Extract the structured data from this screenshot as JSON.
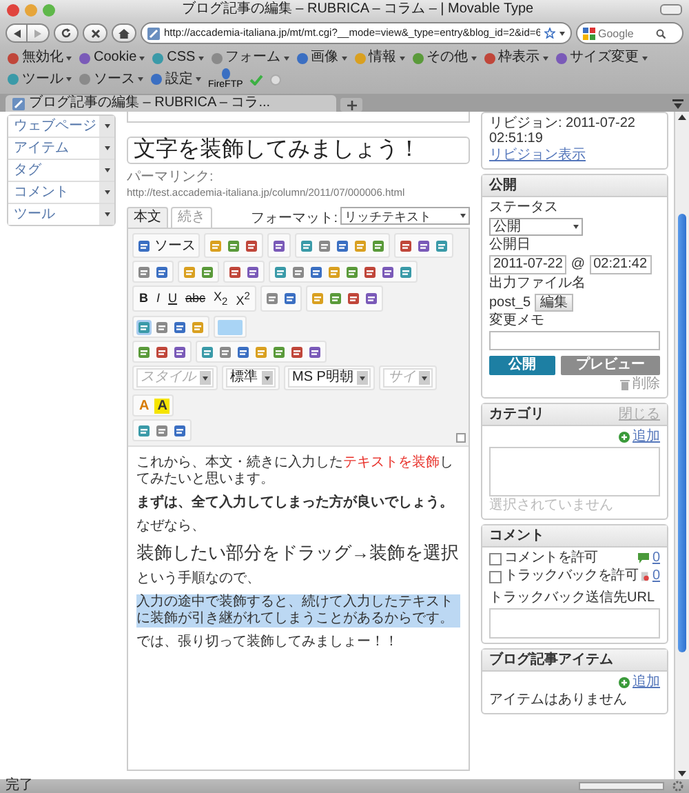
{
  "window": {
    "title": "ブログ記事の編集 – RUBRICA – コラム – | Movable Type"
  },
  "address": {
    "url": "http://accademia-italiana.jp/mt/mt.cgi?__mode=view&_type=entry&blog_id=2&id=6"
  },
  "search": {
    "placeholder": "Google"
  },
  "bookmarks": [
    {
      "label": "無効化",
      "kind": "menu"
    },
    {
      "label": "Cookie",
      "kind": "menu"
    },
    {
      "label": "CSS",
      "kind": "menu"
    },
    {
      "label": "フォーム",
      "kind": "menu"
    },
    {
      "label": "画像",
      "kind": "menu"
    },
    {
      "label": "情報",
      "kind": "menu"
    },
    {
      "label": "その他",
      "kind": "menu"
    },
    {
      "label": "枠表示",
      "kind": "menu"
    },
    {
      "label": "サイズ変更",
      "kind": "menu"
    },
    {
      "label": "ツール",
      "kind": "menu"
    },
    {
      "label": "ソース",
      "kind": "menu"
    },
    {
      "label": "設定",
      "kind": "menu"
    },
    {
      "label": "FireFTP",
      "kind": "button"
    }
  ],
  "tabs": [
    {
      "label": "ブログ記事の編集 – RUBRICA – コラ...",
      "selected": true
    }
  ],
  "sidebar": {
    "items": [
      {
        "label": "ウェブページ"
      },
      {
        "label": "アイテム"
      },
      {
        "label": "タグ"
      },
      {
        "label": "コメント"
      },
      {
        "label": "ツール"
      }
    ]
  },
  "entry": {
    "title": "文字を装飾してみましょう！",
    "permalink_label": "パーマリンク:",
    "permalink": "http://test.accademia-italiana.jp/column/2011/07/000006.html",
    "tabs": [
      {
        "label": "本文",
        "selected": true
      },
      {
        "label": "続き",
        "selected": false
      }
    ],
    "format_label": "フォーマット:",
    "format": "リッチテキスト",
    "toolbar": [
      [
        [
          {
            "kind": "icon_text",
            "text": "ソース"
          }
        ],
        [
          {
            "kind": "icon"
          },
          {
            "kind": "icon"
          },
          {
            "kind": "icon"
          }
        ],
        [
          {
            "kind": "icon"
          }
        ],
        [
          {
            "kind": "icon"
          },
          {
            "kind": "icon"
          },
          {
            "kind": "icon"
          },
          {
            "kind": "icon"
          },
          {
            "kind": "icon"
          }
        ],
        [
          {
            "kind": "icon"
          },
          {
            "kind": "icon"
          },
          {
            "kind": "icon"
          }
        ]
      ],
      [
        [
          {
            "kind": "icon"
          },
          {
            "kind": "icon"
          }
        ],
        [
          {
            "kind": "icon"
          },
          {
            "kind": "icon"
          }
        ],
        [
          {
            "kind": "icon"
          },
          {
            "kind": "icon"
          }
        ],
        [
          {
            "kind": "icon"
          },
          {
            "kind": "icon"
          },
          {
            "kind": "icon"
          },
          {
            "kind": "icon"
          },
          {
            "kind": "icon"
          },
          {
            "kind": "icon"
          },
          {
            "kind": "icon"
          },
          {
            "kind": "icon"
          }
        ]
      ],
      [
        [
          {
            "kind": "text",
            "text": "B"
          },
          {
            "kind": "text",
            "text": "I"
          },
          {
            "kind": "text",
            "text": "U"
          },
          {
            "kind": "text",
            "text": "abc"
          },
          {
            "kind": "text",
            "text": "X$_{2}$"
          },
          {
            "kind": "text",
            "text": "X$^{2}$"
          }
        ],
        [
          {
            "kind": "icon"
          },
          {
            "kind": "icon"
          }
        ],
        [
          {
            "kind": "icon"
          },
          {
            "kind": "icon"
          },
          {
            "kind": "icon"
          },
          {
            "kind": "icon"
          }
        ],
        [
          {
            "kind": "icon",
            "active": true
          },
          {
            "kind": "icon",
            "active": false
          },
          {
            "kind": "icon",
            "active": false
          },
          {
            "kind": "icon",
            "active": false
          }
        ],
        [
          {
            "kind": "swatch"
          }
        ]
      ],
      [
        [
          {
            "kind": "icon"
          },
          {
            "kind": "icon"
          },
          {
            "kind": "icon"
          }
        ],
        [
          {
            "kind": "icon"
          },
          {
            "kind": "icon"
          },
          {
            "kind": "icon"
          },
          {
            "kind": "icon"
          },
          {
            "kind": "icon"
          },
          {
            "kind": "icon"
          },
          {
            "kind": "icon"
          }
        ]
      ],
      [
        [
          {
            "kind": "select",
            "text": "スタイル",
            "disabled": true
          }
        ],
        [
          {
            "kind": "select",
            "text": "標準",
            "disabled": false
          }
        ],
        [
          {
            "kind": "select",
            "text": "MS P明朝",
            "disabled": false
          }
        ],
        [
          {
            "kind": "select",
            "text": "サイ",
            "disabled": true
          }
        ],
        [
          {
            "kind": "fontcolor",
            "text": "A"
          },
          {
            "kind": "bgcolor",
            "text": "A"
          }
        ]
      ],
      [
        [
          {
            "kind": "icon"
          },
          {
            "kind": "icon"
          },
          {
            "kind": "icon"
          }
        ]
      ]
    ],
    "content": [
      {
        "kind": "normal",
        "highlighted": false,
        "parts": [
          {
            "text": "これから、本文・続きに入力した",
            "red": false
          },
          {
            "text": "テキストを装飾",
            "red": true
          },
          {
            "text": "してみたいと思います。",
            "red": false
          }
        ]
      },
      {
        "kind": "bold",
        "highlighted": false,
        "parts": [
          {
            "text": "まずは、全て入力してしまった方が良いでしょう。",
            "red": false
          }
        ]
      },
      {
        "kind": "normal",
        "highlighted": false,
        "parts": [
          {
            "text": "なぜなら、",
            "red": false
          }
        ]
      },
      {
        "kind": "heading",
        "highlighted": false,
        "parts": [
          {
            "text": "装飾したい部分をドラッグ→装飾を選択",
            "red": false
          }
        ]
      },
      {
        "kind": "normal",
        "highlighted": false,
        "parts": [
          {
            "text": "という手順なので、",
            "red": false
          }
        ]
      },
      {
        "kind": "normal",
        "highlighted": true,
        "parts": [
          {
            "text": "入力の途中で装飾すると、続けて入力したテキストに装飾が引き継がれてしまうことがあるからです。",
            "red": false
          }
        ]
      },
      {
        "kind": "normal",
        "highlighted": false,
        "parts": [
          {
            "text": "では、張り切って装飾してみましょー！！",
            "red": false
          }
        ]
      }
    ]
  },
  "revision": {
    "text": "リビジョン: 2011-07-22 02:51:19",
    "link": "リビジョン表示"
  },
  "publish": {
    "title": "公開",
    "status_label": "ステータス",
    "status": "公開",
    "date_label": "公開日",
    "date": "2011-07-22",
    "at": "@",
    "time": "02:21:42",
    "file_label": "出力ファイル名",
    "file": "post_5",
    "edit_button": "編集",
    "memo_label": "変更メモ",
    "publish_button": "公開",
    "preview_button": "プレビュー",
    "delete_link": "削除"
  },
  "category": {
    "title": "カテゴリ",
    "close_link": "閉じる",
    "add_link": "追加",
    "empty": "選択されていません"
  },
  "comments": {
    "title": "コメント",
    "options": [
      {
        "label": "コメントを許可",
        "checked": false,
        "kind": "comment",
        "count": "0"
      },
      {
        "label": "トラックバックを許可",
        "checked": false,
        "kind": "trackback",
        "count": "0"
      }
    ],
    "url_label": "トラックバック送信先URL"
  },
  "items": {
    "title": "ブログ記事アイテム",
    "add_link": "追加",
    "empty": "アイテムはありません"
  },
  "status_bar": {
    "text": "完了"
  }
}
